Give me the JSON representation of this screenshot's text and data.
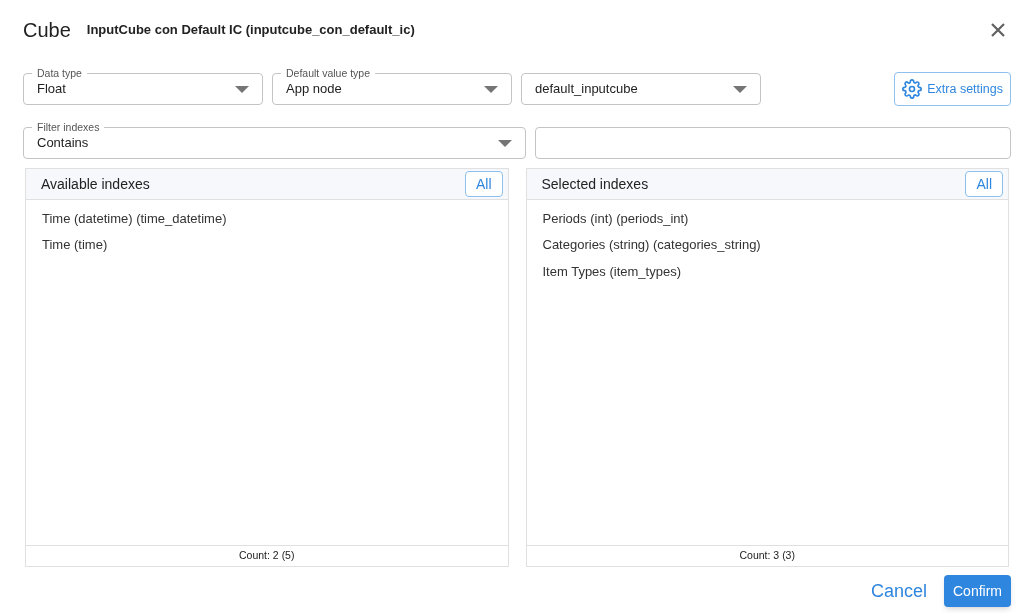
{
  "dialog": {
    "title": "Cube",
    "subtitle": "InputCube con Default IC (inputcube_con_default_ic)"
  },
  "fields": [
    {
      "kind": "select",
      "label": "Data type",
      "value": "Float"
    },
    {
      "kind": "select",
      "label": "Default value type",
      "value": "App node"
    },
    {
      "kind": "select",
      "value": "default_inputcube"
    }
  ],
  "extra_settings": {
    "label": "Extra settings"
  },
  "filter": {
    "label": "Filter indexes",
    "value": "Contains"
  },
  "panels": [
    {
      "title": "Available indexes",
      "all_button": "All",
      "items": [
        "Time (datetime) (time_datetime)",
        "Time (time)"
      ],
      "count": "Count: 2 (5)"
    },
    {
      "title": "Selected indexes",
      "all_button": "All",
      "items": [
        "Periods (int) (periods_int)",
        "Categories (string) (categories_string)",
        "Item Types (item_types)"
      ],
      "count": "Count: 3 (3)"
    }
  ],
  "buttons": {
    "cancel": "Cancel",
    "confirm": "Confirm"
  }
}
